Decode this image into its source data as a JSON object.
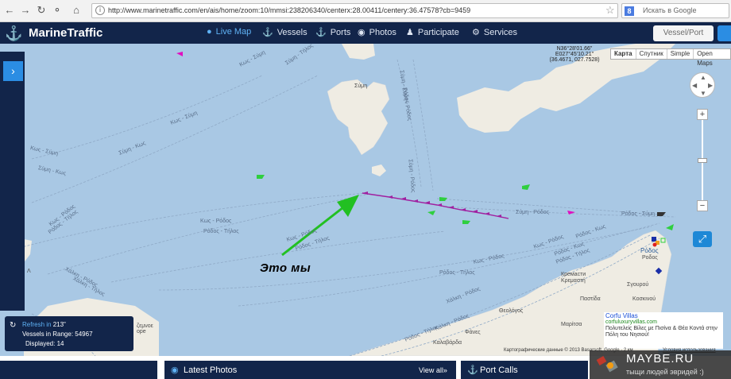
{
  "browser": {
    "url": "http://www.marinetraffic.com/en/ais/home/zoom:10/mmsi:238206340/centerx:28.00411/centery:36.47578?cb=9459",
    "search_placeholder": "Искать в Google",
    "icons": [
      "back-icon",
      "forward-icon",
      "reload-icon",
      "key-icon",
      "home-icon",
      "info-icon",
      "star-icon"
    ]
  },
  "header": {
    "brand": "MarineTraffic",
    "nav": [
      {
        "label": "Live Map",
        "icon": "globe-icon",
        "active": true
      },
      {
        "label": "Vessels",
        "icon": "ship-icon"
      },
      {
        "label": "Ports",
        "icon": "anchor-icon"
      },
      {
        "label": "Photos",
        "icon": "camera-icon"
      },
      {
        "label": "Participate",
        "icon": "person-icon"
      },
      {
        "label": "Services",
        "icon": "gear-icon"
      }
    ],
    "vessel_port_button": "Vessel/Port"
  },
  "map": {
    "coords": {
      "line1": "N36°28'01.66\"",
      "line2": "E027°45'10.21\"",
      "line3": "(36.4671, 027.7528)"
    },
    "map_types": [
      "Карта",
      "Спутник",
      "Simple",
      "Open Maps"
    ],
    "route_labels": [
      "Κως - Σύμη",
      "Κως - Σύμη",
      "Σύμη - Κως",
      "Κως - Σύμη",
      "Σύμη - Τήλος",
      "Σύμη - Ρόδος",
      "Σύμη - Ρόδος",
      "Σύμη - Ρόδος",
      "Σύμη - Ρόδος",
      "Ρόδος - Σύμη",
      "Σύμη - Κως",
      "Κως - Ρόδος",
      "Ρόδος - Τήλος",
      "Ρόδος - Τήλος",
      "Κως - Ρόδος",
      "Ρόδος - Τήλος",
      "Χάλκη - Ρόδος",
      "Χάλκη - Τήλος",
      "Κως - Ρόδος",
      "Κως - Ρόδος",
      "Ρόδος - Τήλος",
      "Κως - Ρόδος",
      "Ρόδος - Κως",
      "Ρόδος - Κως",
      "Ρόδος - Τήλος",
      "Χάλκη - Ρόδος",
      "Ρόδος - Τήλος",
      "Κάλκη - Ρόδος",
      "Ρόδος - Χάλκη"
    ],
    "places": {
      "symi": "Σύμη",
      "rodos_en": "Ροδος",
      "rodos": "Ρόδος",
      "kremasti": "Κρεμαστή",
      "kremasti_ru": "Кремасти",
      "sgourou": "Σγουρού",
      "kosskinou": "Κοσκινού",
      "pastida": "Παστίδα",
      "theologos": "Θεολόγος",
      "maritsa": "Μαρίτσα",
      "kalavarda": "Καλαβάρδα",
      "fanes": "Φάνες",
      "psalidi": "Φαλιράκι",
      "olympos": "ζεμνοε\nоре",
      "lindos_frag": "Λ"
    },
    "annotation": "Это мы",
    "status": {
      "refresh_label": "Refresh in",
      "refresh_value": "213\"",
      "vessels_label": "Vessels in Range:",
      "vessels_value": "54967",
      "displayed_label": "Displayed:",
      "displayed_value": "14"
    },
    "ad": {
      "title": "Corfu Villas",
      "url": "corfuluxuryvillas.com",
      "text": "Πολυτελείς Βίλες με Πισίνα & Θέα Κοντά στην Πόλη του Νησιού!"
    },
    "attribution": "Картографические данные © 2013 Basarsoft, Google · 2 км",
    "attribution_link": "Условия использования"
  },
  "bottom": {
    "latest_photos": "Latest Photos",
    "view_all": "View all»",
    "port_calls": "Port Calls"
  },
  "watermark": {
    "title": "MAYBE.RU",
    "subtitle": "тыщи людей эвридей :)"
  }
}
